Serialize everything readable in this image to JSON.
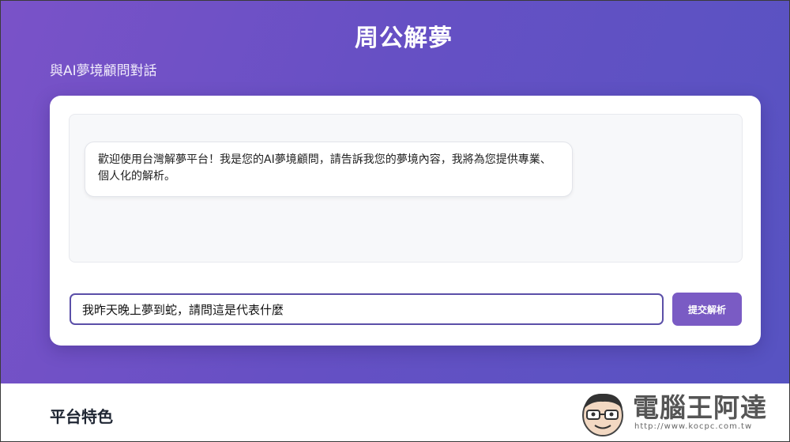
{
  "page": {
    "title": "周公解夢",
    "subtitle": "與AI夢境顧問對話"
  },
  "chat": {
    "messages": [
      {
        "role": "bot",
        "text": "歡迎使用台灣解夢平台！我是您的AI夢境顧問，請告訴我您的夢境內容，我將為您提供專業、個人化的解析。"
      }
    ],
    "input_value": "我昨天晚上夢到蛇，請問這是代表什麼",
    "submit_label": "提交解析"
  },
  "features": {
    "heading": "平台特色"
  },
  "watermark": {
    "brand": "電腦王阿達",
    "url": "http://www.kocpc.com.tw"
  },
  "colors": {
    "hero_gradient_start": "#7a52c8",
    "hero_gradient_end": "#5753c2",
    "accent_button": "#7a5bc4",
    "input_border": "#5b4fa8"
  }
}
